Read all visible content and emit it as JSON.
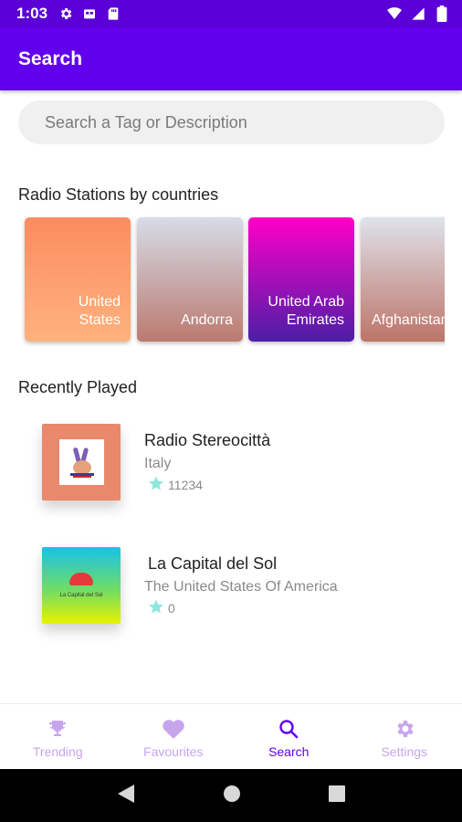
{
  "status_bar": {
    "time": "1:03",
    "icons_left": [
      "gear-icon",
      "sim-card-icon",
      "sd-card-icon"
    ],
    "icons_right": [
      "wifi-icon",
      "signal-icon",
      "battery-icon"
    ]
  },
  "app_bar": {
    "title": "Search"
  },
  "search": {
    "placeholder": "Search a Tag or Description",
    "value": ""
  },
  "countries_section": {
    "title": "Radio Stations by countries",
    "items": [
      {
        "name": "United\nStates"
      },
      {
        "name": "Andorra"
      },
      {
        "name": "United Arab\nEmirates"
      },
      {
        "name": "Afghanistan"
      }
    ]
  },
  "recent_section": {
    "title": "Recently Played",
    "stations": [
      {
        "name": "Radio Stereocittà",
        "country": "Italy",
        "rating": "11234",
        "thumb_icon": "peace-hand-logo-icon"
      },
      {
        "name": "La Capital del Sol",
        "country": "The United States Of America",
        "rating": "0",
        "thumb_icon": "capital-del-sol-logo-icon",
        "thumb_text": "La Capital del Sol"
      }
    ]
  },
  "bottom_nav": {
    "items": [
      {
        "label": "Trending",
        "icon": "trophy-icon",
        "active": false
      },
      {
        "label": "Favourites",
        "icon": "heart-icon",
        "active": false
      },
      {
        "label": "Search",
        "icon": "search-icon",
        "active": true
      },
      {
        "label": "Settings",
        "icon": "gear-icon",
        "active": false
      }
    ]
  },
  "colors": {
    "primary": "#6200ee",
    "status_bar": "#5b00d6",
    "nav_inactive": "#c7a5ee",
    "star": "#8ee6dc"
  }
}
